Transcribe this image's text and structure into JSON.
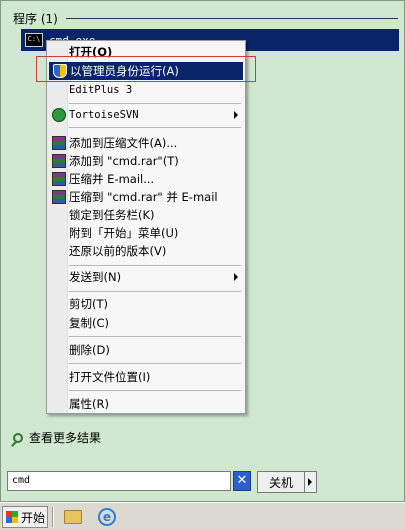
{
  "start_menu": {
    "section_label": "程序 (1)",
    "program": {
      "name": "cmd.exe",
      "icon": "cmd-icon"
    },
    "see_more": "查看更多结果",
    "search": {
      "value": "cmd",
      "clear_glyph": "✕"
    },
    "shutdown_label": "关机"
  },
  "context_menu": {
    "items": [
      {
        "label": "打开(O)",
        "bold": true
      },
      {
        "label": "以管理员身份运行(A)",
        "icon": "uac-shield-icon",
        "highlighted": true
      },
      {
        "label": "EditPlus 3",
        "mono": true
      },
      {
        "label": "TortoiseSVN",
        "icon": "tortoisesvn-icon",
        "submenu": true,
        "mono": true
      },
      {
        "label": "添加到压缩文件(A)...",
        "icon": "winrar-icon"
      },
      {
        "label": "添加到 \"cmd.rar\"(T)",
        "icon": "winrar-icon"
      },
      {
        "label": "压缩并 E-mail...",
        "icon": "winrar-icon"
      },
      {
        "label": "压缩到 \"cmd.rar\" 并 E-mail",
        "icon": "winrar-icon"
      },
      {
        "label": "锁定到任务栏(K)"
      },
      {
        "label": "附到「开始」菜单(U)"
      },
      {
        "label": "还原以前的版本(V)"
      },
      {
        "label": "发送到(N)",
        "submenu": true
      },
      {
        "label": "剪切(T)"
      },
      {
        "label": "复制(C)"
      },
      {
        "label": "删除(D)"
      },
      {
        "label": "打开文件位置(I)"
      },
      {
        "label": "属性(R)"
      }
    ]
  },
  "taskbar": {
    "start_label": "开始",
    "ie_glyph": "e"
  },
  "colors": {
    "panel_bg": "#cfe8cf",
    "selection": "#0a246a",
    "highlight_box": "#d23b3b"
  }
}
